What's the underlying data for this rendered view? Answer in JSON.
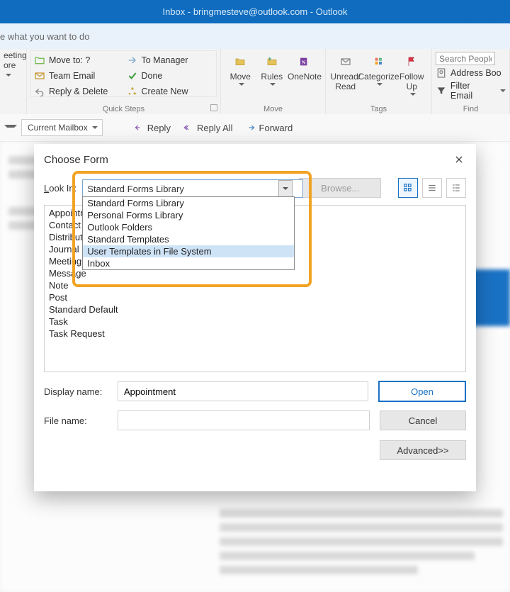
{
  "title": "Inbox - bringmesteve@outlook.com  -  Outlook",
  "search_hint": "e what you want to do",
  "ribbon": {
    "meeting": {
      "top": "eeting",
      "more": "ore"
    },
    "quick": {
      "items": [
        "Move to: ?",
        "To Manager",
        "Team Email",
        "Done",
        "Reply & Delete",
        "Create New"
      ],
      "label": "Quick Steps"
    },
    "move": {
      "move": "Move",
      "rules": "Rules",
      "onenote": "OneNote",
      "label": "Move"
    },
    "tags": {
      "unread": "Unread/\nRead",
      "categorize": "Categorize",
      "follow": "Follow\nUp",
      "label": "Tags"
    },
    "find": {
      "placeholder": "Search People",
      "address": "Address Boo",
      "filter": "Filter Email",
      "label": "Find"
    }
  },
  "strip": {
    "scope": "Current Mailbox",
    "reply": "Reply",
    "replyall": "Reply All",
    "forward": "Forward"
  },
  "dialog": {
    "title": "Choose Form",
    "look_in_label": "Look In:",
    "look_in_value": "Standard Forms Library",
    "dropdown_options": [
      "Standard Forms Library",
      "Personal Forms Library",
      "Outlook Folders",
      "Standard Templates",
      "User Templates in File System",
      "Inbox"
    ],
    "dropdown_highlight_index": 4,
    "browse": "Browse...",
    "list_items": [
      "Appointment",
      "Contact",
      "Distribution List",
      "Journal Entry",
      "Meeting Request",
      "Message",
      "Note",
      "Post",
      "Standard Default",
      "Task",
      "Task Request"
    ],
    "display_name_label": "Display name:",
    "display_name_value": "Appointment",
    "file_name_label": "File name:",
    "file_name_value": "",
    "open": "Open",
    "cancel": "Cancel",
    "advanced": "Advanced>>"
  }
}
